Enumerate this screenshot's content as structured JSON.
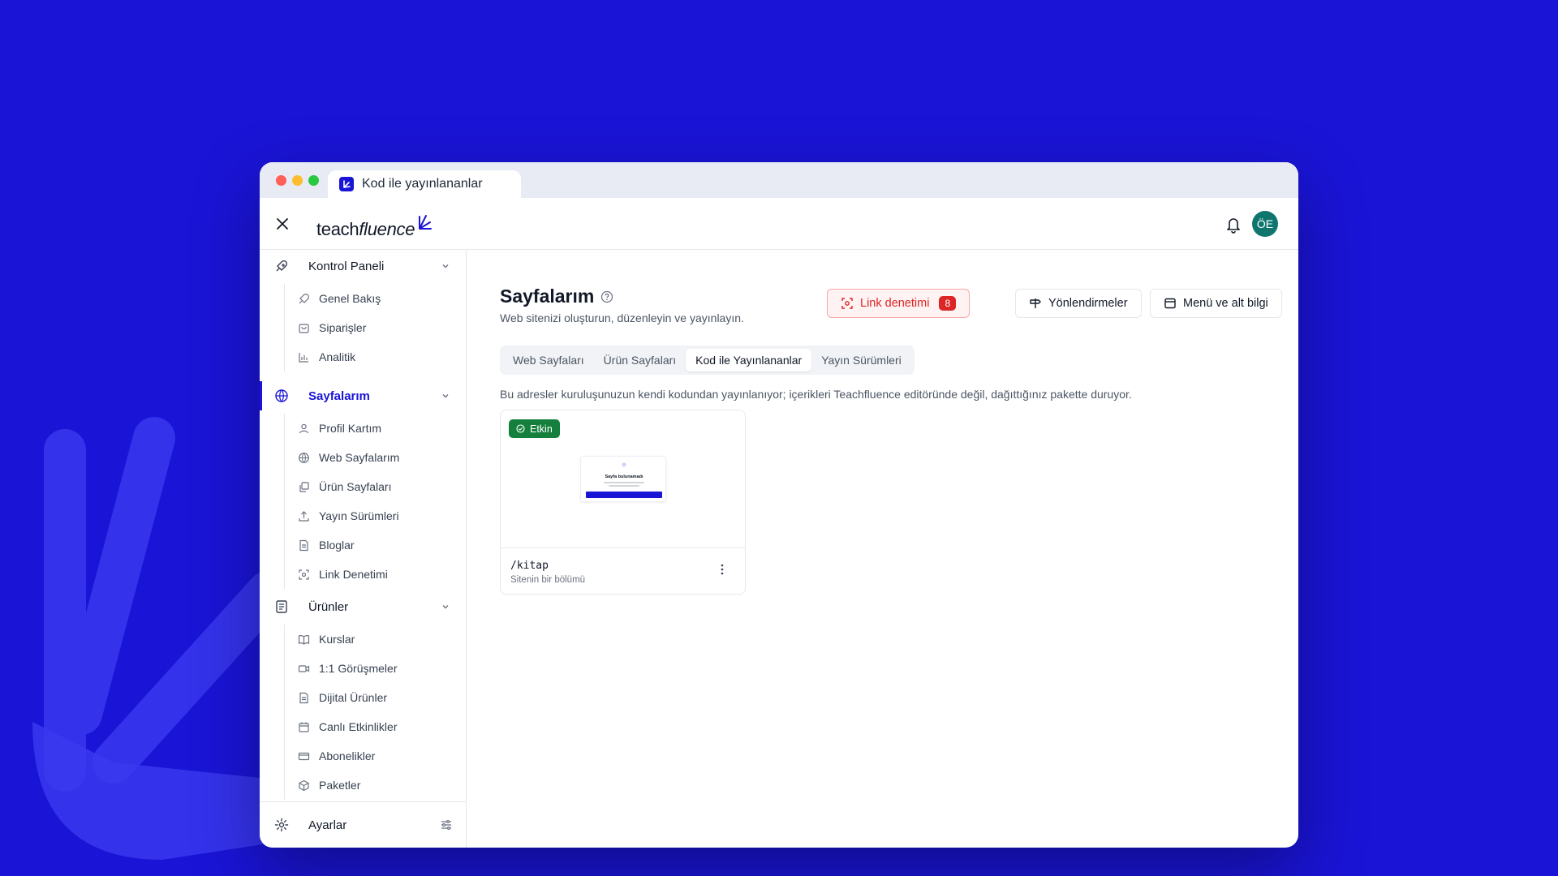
{
  "browser": {
    "tab_title": "Kod ile yayınlananlar"
  },
  "header": {
    "logo_main": "teach",
    "logo_accent": "fluence",
    "avatar_initials": "ÖE"
  },
  "sidebar": {
    "groups": [
      {
        "label": "Kontrol Paneli",
        "items": [
          "Genel Bakış",
          "Siparişler",
          "Analitik"
        ]
      },
      {
        "label": "Sayfalarım",
        "active": true,
        "items": [
          "Profil Kartım",
          "Web Sayfalarım",
          "Ürün Sayfaları",
          "Yayın Sürümleri",
          "Bloglar",
          "Link Denetimi"
        ]
      },
      {
        "label": "Ürünler",
        "items": [
          "Kurslar",
          "1:1 Görüşmeler",
          "Dijital Ürünler",
          "Canlı Etkinlikler",
          "Abonelikler",
          "Paketler"
        ]
      }
    ],
    "footer_label": "Ayarlar"
  },
  "main": {
    "title": "Sayfalarım",
    "subtitle": "Web sitenizi oluşturun, düzenleyin ve yayınlayın.",
    "actions": {
      "link_audit": "Link denetimi",
      "link_audit_count": "8",
      "redirects": "Yönlendirmeler",
      "menu_footer": "Menü ve alt bilgi"
    },
    "tabs": [
      "Web Sayfaları",
      "Ürün Sayfaları",
      "Kod ile Yayınlananlar",
      "Yayın Sürümleri"
    ],
    "selected_tab": 2,
    "description": "Bu adresler kuruluşunuzun kendi kodundan yayınlanıyor; içerikleri Teachfluence editöründe değil, dağıttığınız pakette duruyor.",
    "cards": [
      {
        "status": "Etkin",
        "preview_title": "Sayfa bulunamadı",
        "path": "/kitap",
        "meta": "Sitenin bir bölümü"
      }
    ]
  },
  "colors": {
    "brand": "#1a14d6",
    "danger": "#dc2626",
    "success": "#15803d",
    "avatar": "#0f766e"
  },
  "icons": {
    "close": "x-icon",
    "bell": "bell-icon",
    "help": "help-circle-icon"
  }
}
